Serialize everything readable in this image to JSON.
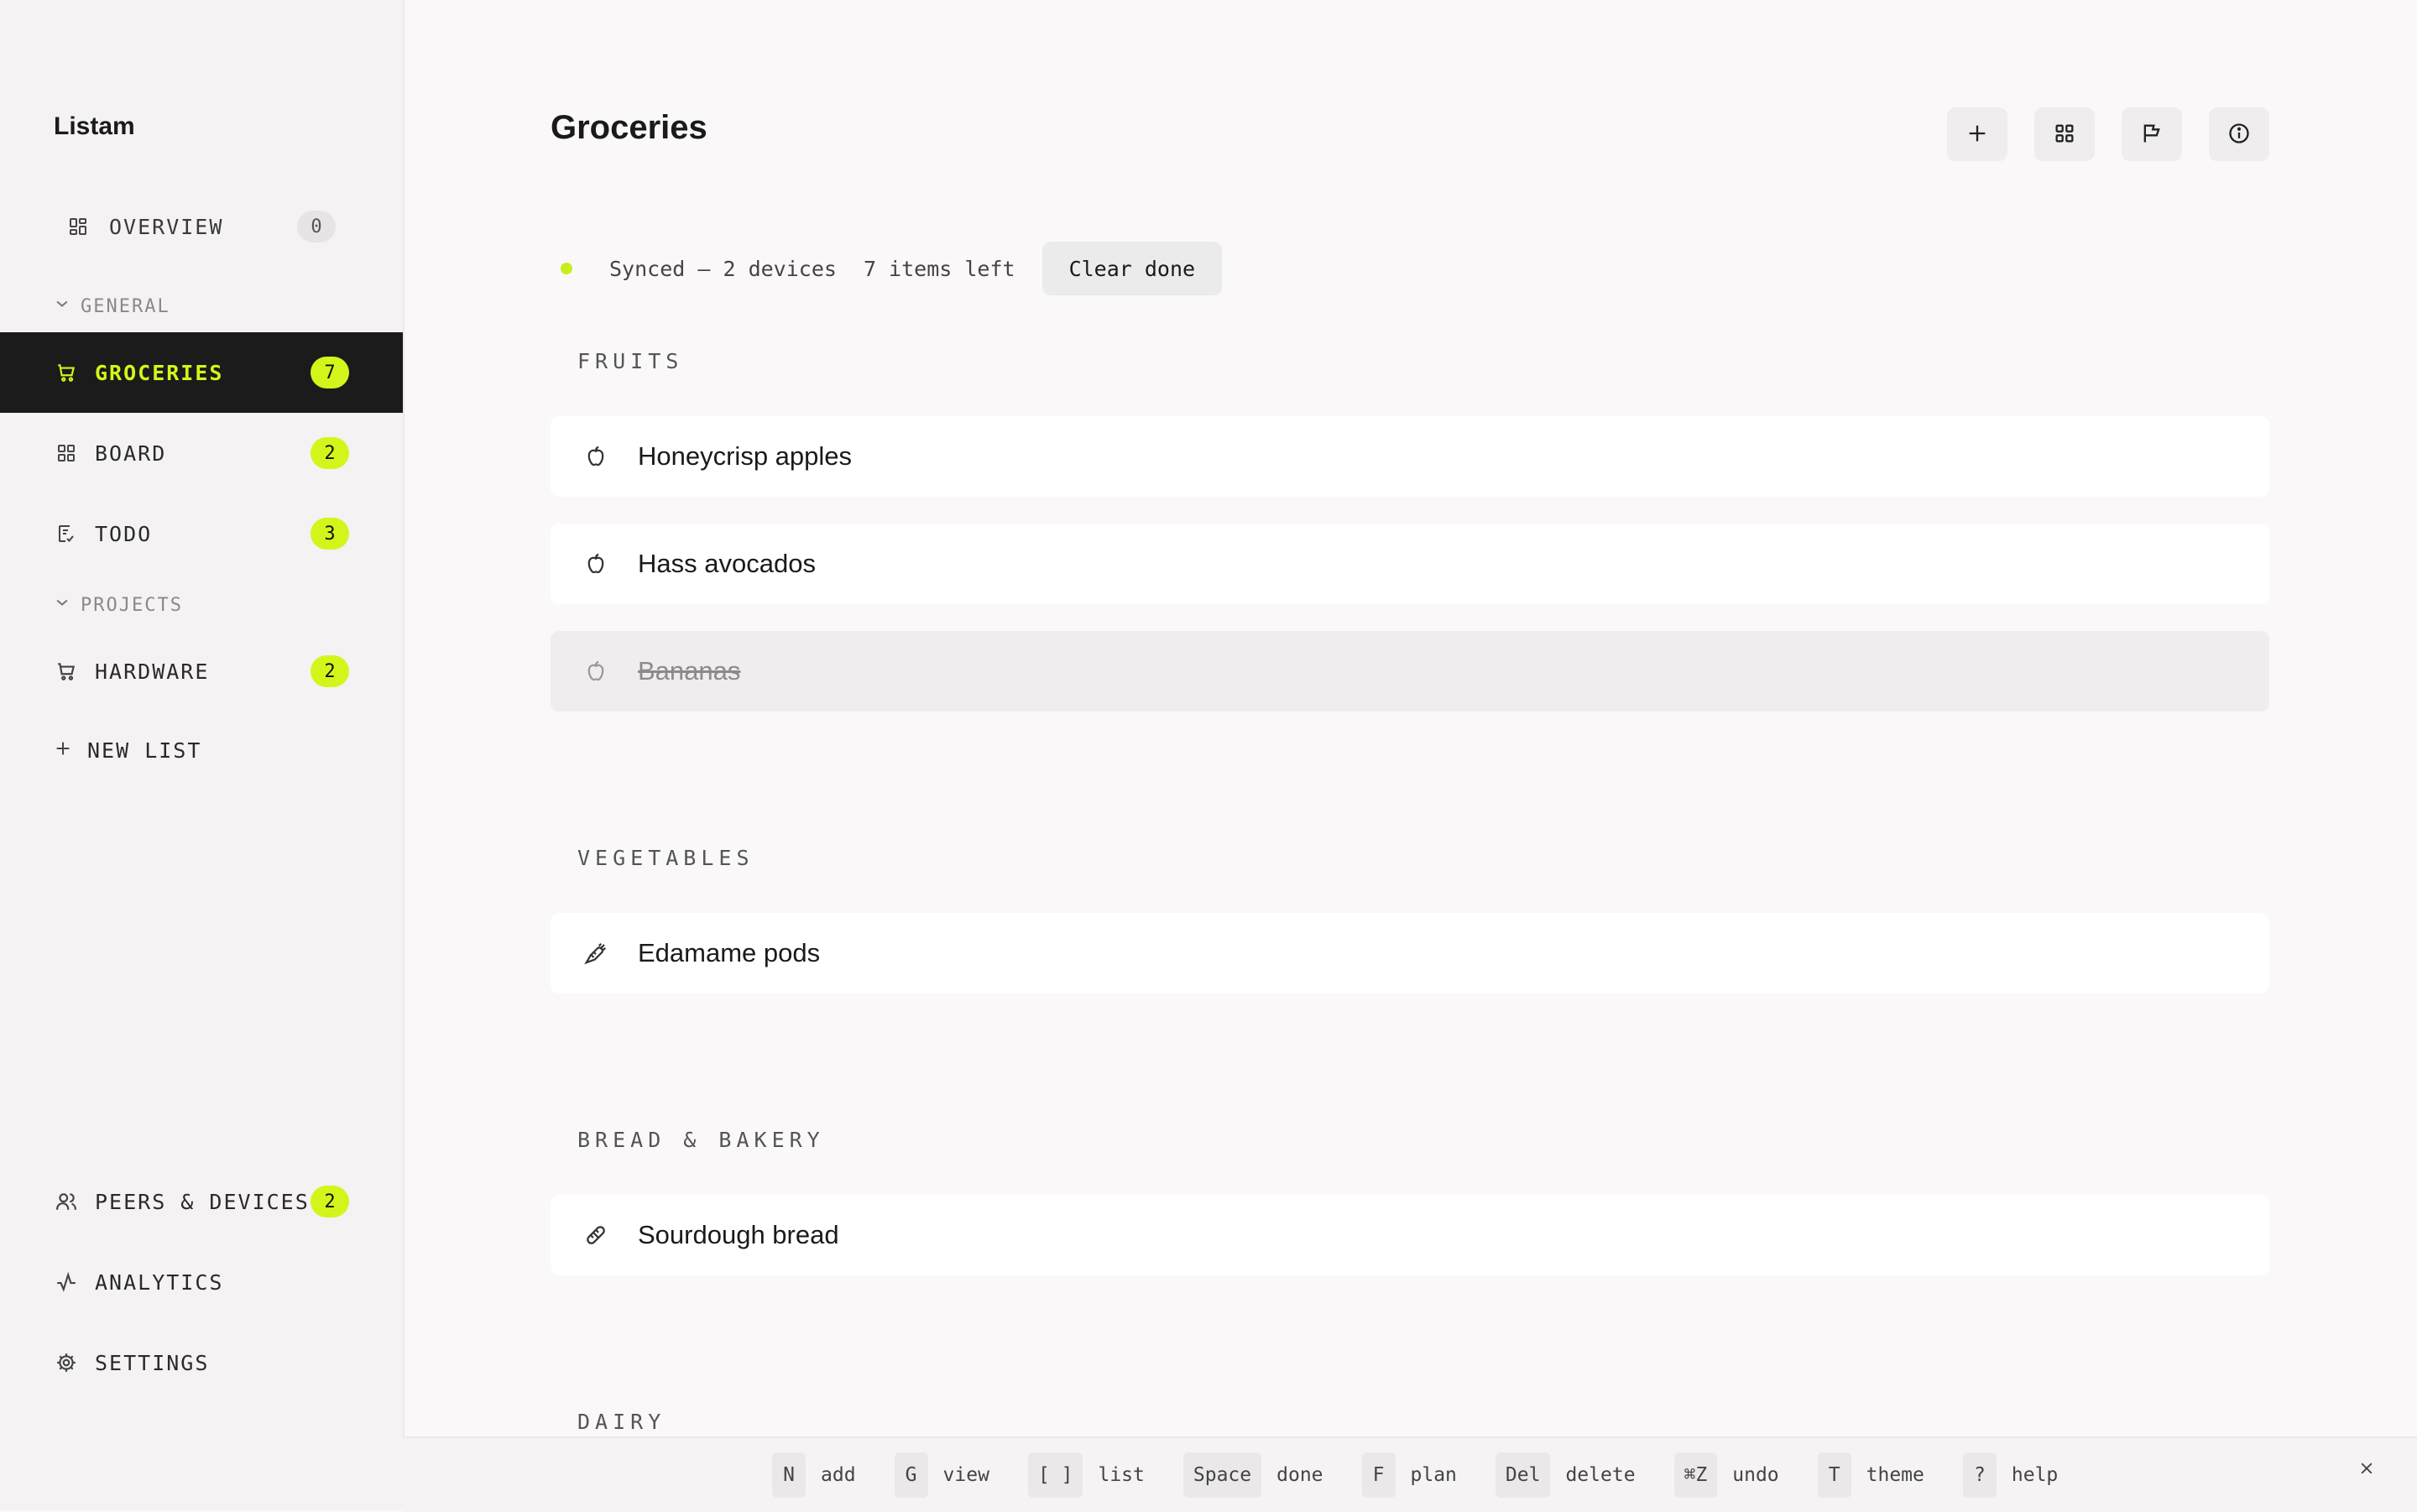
{
  "app": {
    "title": "Listam"
  },
  "colors": {
    "accent": "#d4f51a",
    "sidebar_active_bg": "#1b1b1b",
    "status_dot": "#c6ef1a"
  },
  "sidebar": {
    "overview": {
      "label": "OVERVIEW",
      "count": "0",
      "icon": "overview-icon"
    },
    "sections": [
      {
        "title": "GENERAL",
        "items": [
          {
            "label": "GROCERIES",
            "count": "7",
            "icon": "cart-icon",
            "active": true
          },
          {
            "label": "BOARD",
            "count": "2",
            "icon": "grid-icon"
          },
          {
            "label": "TODO",
            "count": "3",
            "icon": "checklist-icon"
          }
        ]
      },
      {
        "title": "PROJECTS",
        "items": [
          {
            "label": "HARDWARE",
            "count": "2",
            "icon": "cart-icon"
          }
        ]
      }
    ],
    "new_list": "NEW LIST",
    "bottom": [
      {
        "label": "PEERS & DEVICES",
        "count": "2",
        "icon": "users-icon"
      },
      {
        "label": "ANALYTICS",
        "icon": "activity-icon"
      },
      {
        "label": "SETTINGS",
        "icon": "gear-icon"
      }
    ]
  },
  "main": {
    "title": "Groceries",
    "toolbar": [
      "add-icon",
      "grid-view-icon",
      "flag-icon",
      "info-icon"
    ],
    "status": {
      "sync": "Synced – 2 devices",
      "left": "7 items left",
      "clear": "Clear done"
    },
    "categories": [
      {
        "name": "FRUITS",
        "items": [
          {
            "name": "Honeycrisp apples",
            "icon": "apple-icon",
            "done": false
          },
          {
            "name": "Hass avocados",
            "icon": "apple-icon",
            "done": false
          },
          {
            "name": "Bananas",
            "icon": "apple-icon",
            "done": true
          }
        ]
      },
      {
        "name": "VEGETABLES",
        "items": [
          {
            "name": "Edamame pods",
            "icon": "carrot-icon",
            "done": false
          }
        ]
      },
      {
        "name": "BREAD & BAKERY",
        "items": [
          {
            "name": "Sourdough bread",
            "icon": "bread-icon",
            "done": false
          }
        ]
      },
      {
        "name": "DAIRY",
        "items": []
      }
    ]
  },
  "shortcuts": [
    {
      "key": "N",
      "label": "add"
    },
    {
      "key": "G",
      "label": "view"
    },
    {
      "key": "[ ]",
      "label": "list"
    },
    {
      "key": "Space",
      "label": "done"
    },
    {
      "key": "F",
      "label": "plan"
    },
    {
      "key": "Del",
      "label": "delete"
    },
    {
      "key": "⌘Z",
      "label": "undo"
    },
    {
      "key": "T",
      "label": "theme"
    },
    {
      "key": "?",
      "label": "help"
    }
  ]
}
